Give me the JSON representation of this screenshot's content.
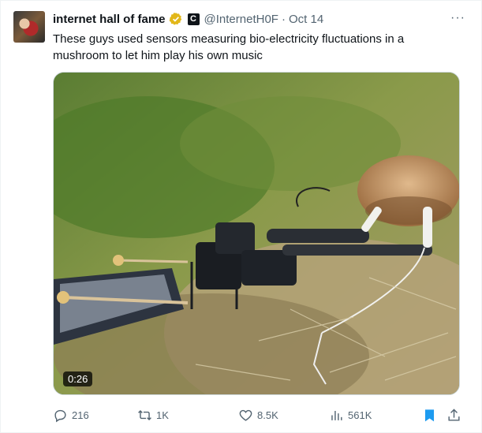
{
  "tweet": {
    "author_name": "internet hall of fame",
    "affiliate_badge": "C",
    "handle": "@InternetH0F",
    "separator": "·",
    "date": "Oct 14",
    "more_label": "···",
    "text": "These guys used sensors measuring bio-electricity fluctuations in a mushroom to let him play his own music",
    "video_duration": "0:26",
    "verified_color": "#e2b719"
  },
  "actions": {
    "replies": "216",
    "retweets": "1K",
    "likes": "8.5K",
    "views": "561K"
  },
  "colors": {
    "muted": "#536471",
    "bookmark": "#1d9bf0"
  }
}
